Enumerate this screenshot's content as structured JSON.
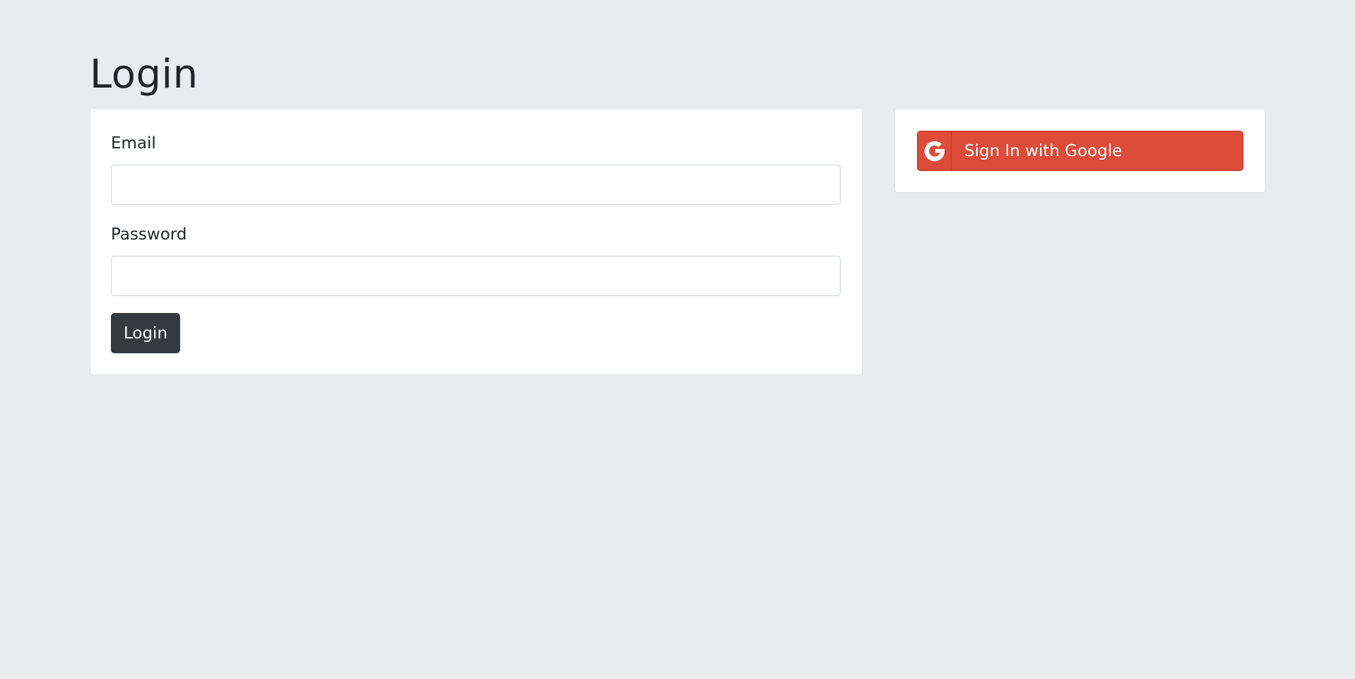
{
  "page": {
    "title": "Login"
  },
  "login_form": {
    "email_label": "Email",
    "email_value": "",
    "email_placeholder": "",
    "password_label": "Password",
    "password_value": "",
    "password_placeholder": "",
    "submit_label": "Login"
  },
  "social": {
    "google_label": "Sign In with Google",
    "google_icon": "google-g-icon"
  },
  "colors": {
    "background": "#e9ecef",
    "card": "#ffffff",
    "primary_dark": "#343a40",
    "google_red": "#dd4b39"
  }
}
